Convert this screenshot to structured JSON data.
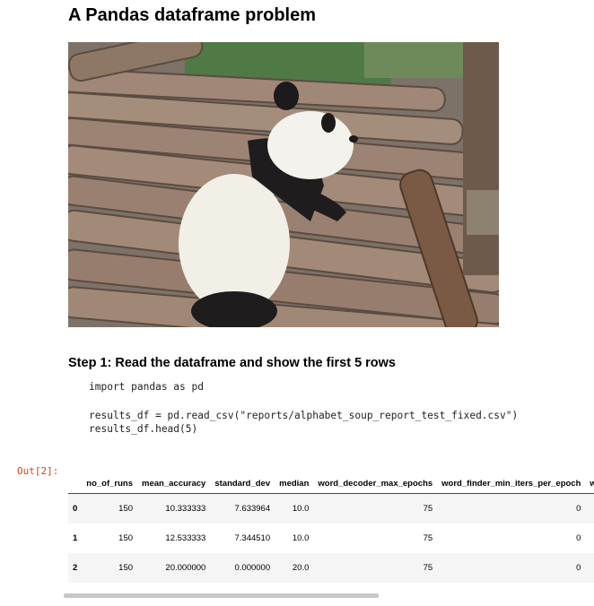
{
  "notebook": {
    "title": "A Pandas dataframe problem",
    "step1_heading": "Step 1: Read the dataframe and show the first 5 rows",
    "code": "import pandas as pd\n\nresults_df = pd.read_csv(\"reports/alphabet_soup_report_test_fixed.csv\")\nresults_df.head(5)",
    "out_prompt": "Out[2]:"
  },
  "image": {
    "description_icon": "panda-photo"
  },
  "table": {
    "columns": [
      "",
      "no_of_runs",
      "mean_accuracy",
      "standard_dev",
      "median",
      "word_decoder_max_epochs",
      "word_finder_min_iters_per_epoch",
      "w"
    ],
    "rows": [
      [
        "0",
        "150",
        "10.333333",
        "7.633964",
        "10.0",
        "75",
        "0",
        ""
      ],
      [
        "1",
        "150",
        "12.533333",
        "7.344510",
        "10.0",
        "75",
        "0",
        ""
      ],
      [
        "2",
        "150",
        "20.000000",
        "0.000000",
        "20.0",
        "75",
        "0",
        ""
      ]
    ]
  }
}
